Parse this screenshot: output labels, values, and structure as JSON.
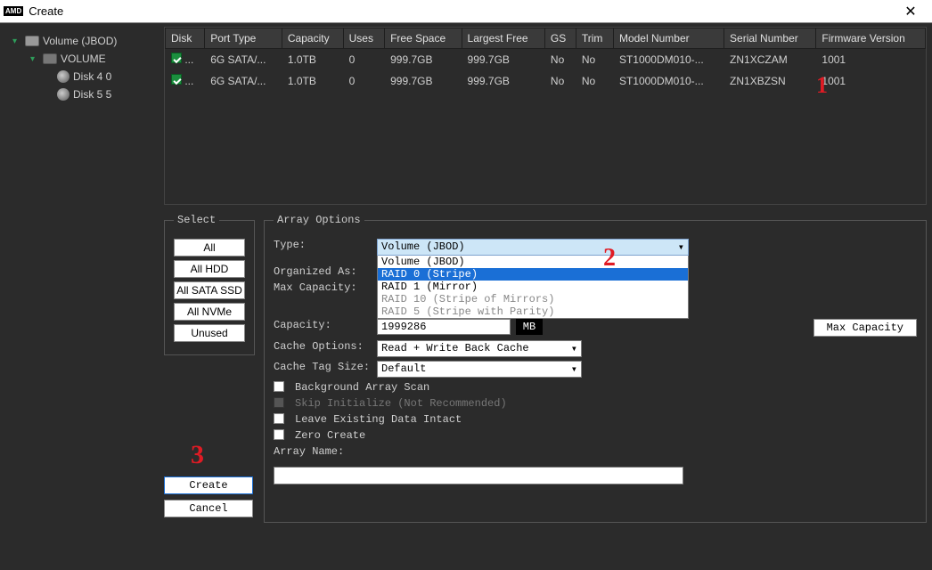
{
  "window": {
    "logo": "AMD",
    "title": "Create",
    "close": "✕"
  },
  "tree": {
    "root": "Volume  (JBOD)",
    "volume": "VOLUME",
    "disk4": "Disk 4 0",
    "disk5": "Disk 5 5"
  },
  "table": {
    "headers": {
      "disk": "Disk",
      "port_type": "Port Type",
      "capacity": "Capacity",
      "uses": "Uses",
      "free_space": "Free Space",
      "largest_free": "Largest Free",
      "gs": "GS",
      "trim": "Trim",
      "model": "Model Number",
      "serial": "Serial Number",
      "firmware": "Firmware Version"
    },
    "rows": [
      {
        "disk": "...",
        "port_type": "6G SATA/...",
        "capacity": "1.0TB",
        "uses": "0",
        "free_space": "999.7GB",
        "largest_free": "999.7GB",
        "gs": "No",
        "trim": "No",
        "model": "ST1000DM010-...",
        "serial": "ZN1XCZAM",
        "firmware": "1001"
      },
      {
        "disk": "...",
        "port_type": "6G SATA/...",
        "capacity": "1.0TB",
        "uses": "0",
        "free_space": "999.7GB",
        "largest_free": "999.7GB",
        "gs": "No",
        "trim": "No",
        "model": "ST1000DM010-...",
        "serial": "ZN1XBZSN",
        "firmware": "1001"
      }
    ]
  },
  "select_group": {
    "legend": "Select",
    "all": "All",
    "all_hdd": "All HDD",
    "all_sata_ssd": "All SATA SSD",
    "all_nvme": "All NVMe",
    "unused": "Unused"
  },
  "array": {
    "legend": "Array Options",
    "type_label": "Type:",
    "type_selected": "Volume  (JBOD)",
    "type_options": {
      "jbod": "Volume  (JBOD)",
      "raid0": "RAID 0  (Stripe)",
      "raid1": "RAID 1  (Mirror)",
      "raid10": "RAID 10 (Stripe of Mirrors)",
      "raid5": "RAID 5  (Stripe with Parity)"
    },
    "organized_as": "Organized As:",
    "max_capacity_label": "Max Capacity:",
    "capacity_label": "Capacity:",
    "capacity_value": "1999286",
    "capacity_unit": "MB",
    "max_capacity_btn": "Max Capacity",
    "cache_options_label": "Cache Options:",
    "cache_options_value": "Read + Write Back Cache",
    "cache_tag_label": "Cache Tag Size:",
    "cache_tag_value": "Default",
    "bg_scan": "Background Array Scan",
    "skip_init": "Skip Initialize  (Not Recommended)",
    "leave_data": "Leave Existing Data Intact",
    "zero_create": "Zero Create",
    "array_name": "Array Name:"
  },
  "actions": {
    "create": "Create",
    "cancel": "Cancel"
  },
  "annotations": {
    "one": "1",
    "two": "2",
    "three": "3"
  }
}
